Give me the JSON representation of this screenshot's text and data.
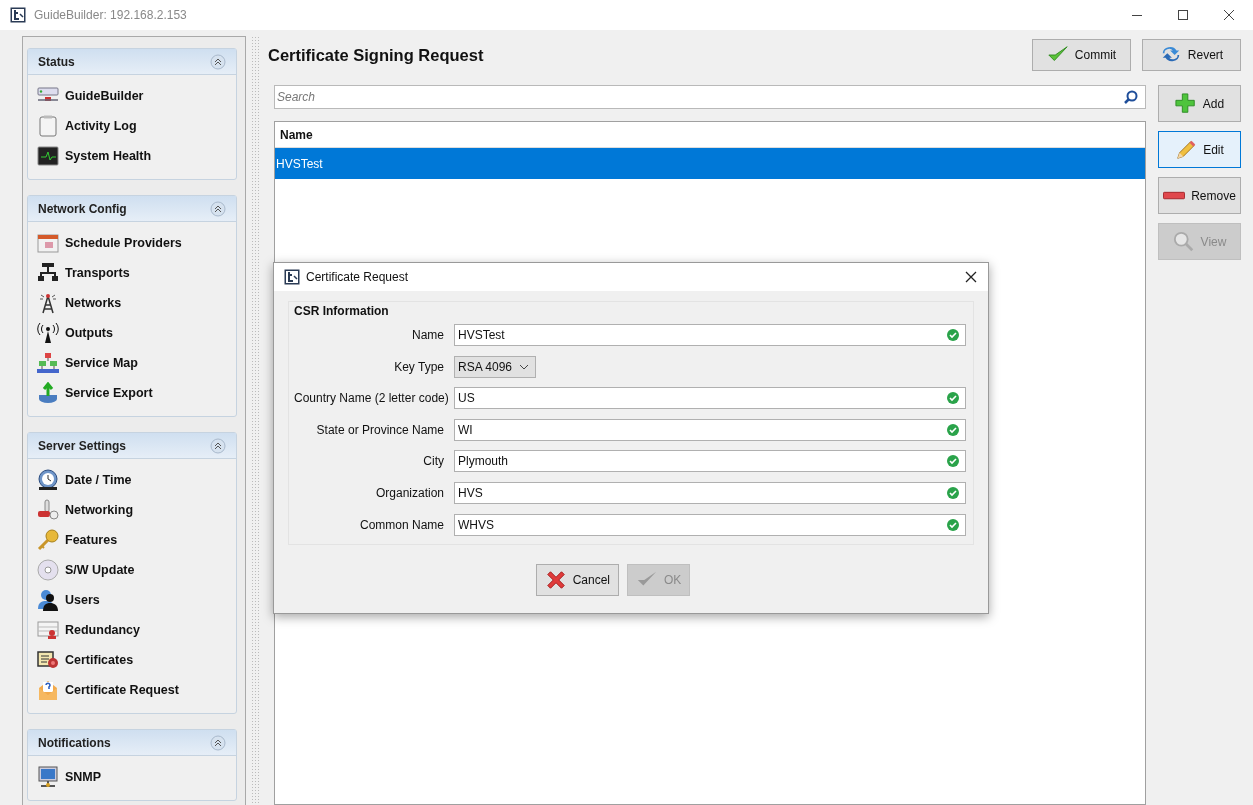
{
  "window": {
    "title": "GuideBuilder: 192.168.2.153"
  },
  "sidebar": {
    "sections": [
      {
        "title": "Status",
        "expanded": true,
        "items": [
          {
            "label": "GuideBuilder"
          },
          {
            "label": "Activity Log"
          },
          {
            "label": "System Health"
          }
        ]
      },
      {
        "title": "Network Config",
        "expanded": true,
        "items": [
          {
            "label": "Schedule Providers"
          },
          {
            "label": "Transports"
          },
          {
            "label": "Networks"
          },
          {
            "label": "Outputs"
          },
          {
            "label": "Service Map"
          },
          {
            "label": "Service Export"
          }
        ]
      },
      {
        "title": "Server Settings",
        "expanded": true,
        "items": [
          {
            "label": "Date / Time"
          },
          {
            "label": "Networking"
          },
          {
            "label": "Features"
          },
          {
            "label": "S/W Update"
          },
          {
            "label": "Users"
          },
          {
            "label": "Redundancy"
          },
          {
            "label": "Certificates"
          },
          {
            "label": "Certificate Request"
          }
        ]
      },
      {
        "title": "Notifications",
        "expanded": true,
        "items": [
          {
            "label": "SNMP"
          }
        ]
      }
    ]
  },
  "main": {
    "title": "Certificate Signing Request",
    "header_buttons": [
      {
        "label": "Commit",
        "kind": "commit"
      },
      {
        "label": "Revert",
        "kind": "revert"
      }
    ],
    "search": {
      "placeholder": "Search"
    },
    "table": {
      "columns": [
        "Name"
      ],
      "rows": [
        {
          "name": "HVSTest",
          "selected": true
        }
      ]
    },
    "side_buttons": [
      {
        "label": "Add",
        "kind": "add",
        "focused": false,
        "disabled": false
      },
      {
        "label": "Edit",
        "kind": "edit",
        "focused": true,
        "disabled": false
      },
      {
        "label": "Remove",
        "kind": "remove",
        "focused": false,
        "disabled": false
      },
      {
        "label": "View",
        "kind": "view",
        "focused": false,
        "disabled": true
      }
    ]
  },
  "dialog": {
    "title": "Certificate Request",
    "group_title": "CSR Information",
    "fields": [
      {
        "label": "Name",
        "kind": "text",
        "value": "HVSTest",
        "valid": true
      },
      {
        "label": "Key Type",
        "kind": "dropdown",
        "value": "RSA 4096"
      },
      {
        "label": "Country Name (2 letter code)",
        "kind": "text",
        "value": "US",
        "valid": true
      },
      {
        "label": "State or Province Name",
        "kind": "text",
        "value": "WI",
        "valid": true
      },
      {
        "label": "City",
        "kind": "text",
        "value": "Plymouth",
        "valid": true
      },
      {
        "label": "Organization",
        "kind": "text",
        "value": "HVS",
        "valid": true
      },
      {
        "label": "Common Name",
        "kind": "text",
        "value": "WHVS",
        "valid": true
      }
    ],
    "buttons": [
      {
        "label": "Cancel",
        "kind": "cancel",
        "disabled": false
      },
      {
        "label": "OK",
        "kind": "ok",
        "disabled": true
      }
    ]
  }
}
